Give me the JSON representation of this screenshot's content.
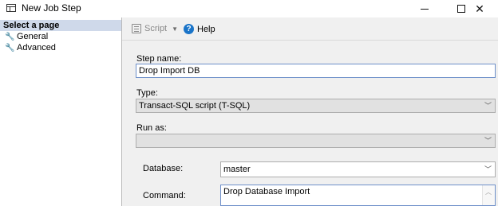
{
  "window": {
    "title": "New Job Step",
    "minimize": "–",
    "maximize": "",
    "close": "✕"
  },
  "sidebar": {
    "header": "Select a page",
    "items": [
      {
        "label": "General",
        "icon": "wrench-icon",
        "selected": true
      },
      {
        "label": "Advanced",
        "icon": "wrench-icon",
        "selected": false
      }
    ]
  },
  "toolbar": {
    "script_label": "Script",
    "help_label": "Help"
  },
  "form": {
    "step_name_label": "Step name:",
    "step_name_value": "Drop Import DB",
    "type_label": "Type:",
    "type_value": "Transact-SQL script (T-SQL)",
    "run_as_label": "Run as:",
    "run_as_value": "",
    "database_label": "Database:",
    "database_value": "master",
    "command_label": "Command:",
    "command_value": "Drop Database Import"
  },
  "colors": {
    "sidebar_header_bg": "#cfd9ea",
    "panel_bg": "#f0f0f0",
    "help_icon": "#1a74c8",
    "focus_border": "#6d8fc9"
  }
}
